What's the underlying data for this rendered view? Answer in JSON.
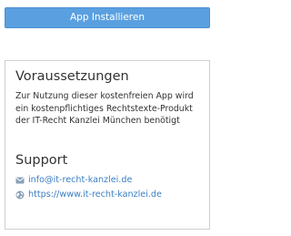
{
  "install_button": {
    "label": "App Installieren"
  },
  "requirements": {
    "title": "Voraussetzungen",
    "text": "Zur Nutzung dieser kostenfreien App wird ein kostenpflichtiges Rechtstexte-Produkt der IT-Recht Kanzlei München benötigt"
  },
  "support": {
    "title": "Support",
    "email": "info@it-recht-kanzlei.de",
    "website": "https://www.it-recht-kanzlei.de"
  },
  "icons": {
    "email": "envelope-icon",
    "website": "globe-icon"
  },
  "colors": {
    "button_bg": "#5aa0e0",
    "link": "#3b7fc4",
    "border": "#cfcfcf",
    "icon": "#8aa1b8"
  }
}
